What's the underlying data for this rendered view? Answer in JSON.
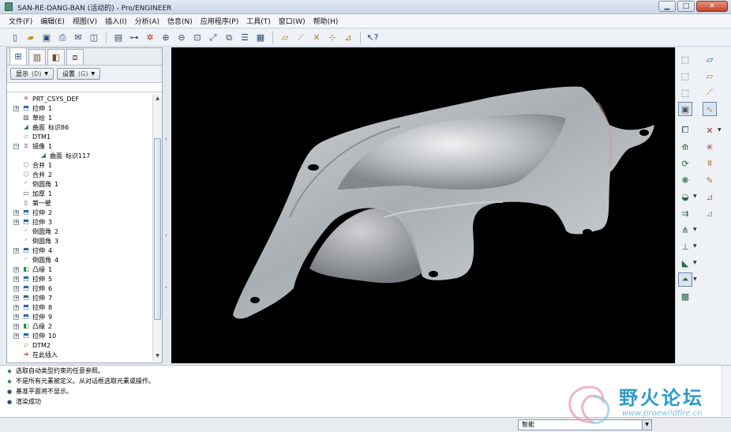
{
  "window": {
    "title": "SAN-RE-DANG-BAN (活动的) - Pro/ENGINEER"
  },
  "menu": [
    "文件(F)",
    "编辑(E)",
    "视图(V)",
    "插入(I)",
    "分析(A)",
    "信息(N)",
    "应用程序(P)",
    "工具(T)",
    "窗口(W)",
    "帮助(H)"
  ],
  "toolbar_icons": [
    "new-icon",
    "open-icon",
    "save-icon",
    "print-icon",
    "email-icon",
    "close-window-icon",
    "regenerate-icon",
    "datum-display-icon",
    "spin-center-icon",
    "zoom-in-icon",
    "zoom-out-icon",
    "refit-icon",
    "reorient-icon",
    "saved-views-icon",
    "layers-icon",
    "view-manager-icon",
    "plane-display-icon",
    "axis-display-icon",
    "point-display-icon",
    "csys-display-icon",
    "annotation-display-icon",
    "context-help-icon"
  ],
  "left_panel": {
    "show_label": "显示",
    "show_hint": "(D)",
    "settings_label": "设置",
    "settings_hint": "(G)"
  },
  "model_tree": [
    {
      "label": "PRT_CSYS_DEF",
      "suffix": "",
      "icon": "csys-icon",
      "level": 1,
      "expand": false
    },
    {
      "label": "拉伸",
      "suffix": "1",
      "icon": "extrude-icon",
      "level": 1,
      "expand": true
    },
    {
      "label": "草绘",
      "suffix": "1",
      "icon": "sketch-icon",
      "level": 1,
      "expand": false
    },
    {
      "label": "曲面",
      "suffix": "标识86",
      "icon": "surface-icon",
      "level": 1,
      "expand": false
    },
    {
      "label": "DTM1",
      "suffix": "",
      "icon": "datum-plane-icon",
      "level": 1,
      "expand": false
    },
    {
      "label": "镜像",
      "suffix": "1",
      "icon": "mirror-icon",
      "level": 1,
      "expand": true,
      "open": true
    },
    {
      "label": "曲面",
      "suffix": "标识117",
      "icon": "surface-icon",
      "level": 2,
      "expand": false
    },
    {
      "label": "合并",
      "suffix": "1",
      "icon": "merge-icon",
      "level": 1,
      "expand": false
    },
    {
      "label": "合并",
      "suffix": "2",
      "icon": "merge-icon",
      "level": 1,
      "expand": false
    },
    {
      "label": "倒圆角",
      "suffix": "1",
      "icon": "round-icon",
      "level": 1,
      "expand": false
    },
    {
      "label": "加厚",
      "suffix": "1",
      "icon": "thicken-icon",
      "level": 1,
      "expand": false
    },
    {
      "label": "第一壁",
      "suffix": "",
      "icon": "wall-icon",
      "level": 1,
      "expand": false
    },
    {
      "label": "拉伸",
      "suffix": "2",
      "icon": "extrude-icon",
      "level": 1,
      "expand": true
    },
    {
      "label": "拉伸",
      "suffix": "3",
      "icon": "extrude-icon",
      "level": 1,
      "expand": true
    },
    {
      "label": "倒圆角",
      "suffix": "2",
      "icon": "round-icon",
      "level": 1,
      "expand": false
    },
    {
      "label": "倒圆角",
      "suffix": "3",
      "icon": "round-icon",
      "level": 1,
      "expand": false
    },
    {
      "label": "拉伸",
      "suffix": "4",
      "icon": "extrude-icon",
      "level": 1,
      "expand": true
    },
    {
      "label": "倒圆角",
      "suffix": "4",
      "icon": "round-icon",
      "level": 1,
      "expand": false
    },
    {
      "label": "凸缘",
      "suffix": "1",
      "icon": "flange-icon",
      "level": 1,
      "expand": true
    },
    {
      "label": "拉伸",
      "suffix": "5",
      "icon": "extrude-icon",
      "level": 1,
      "expand": true
    },
    {
      "label": "拉伸",
      "suffix": "6",
      "icon": "extrude-icon",
      "level": 1,
      "expand": true
    },
    {
      "label": "拉伸",
      "suffix": "7",
      "icon": "extrude-icon",
      "level": 1,
      "expand": true
    },
    {
      "label": "拉伸",
      "suffix": "8",
      "icon": "extrude-icon",
      "level": 1,
      "expand": true
    },
    {
      "label": "拉伸",
      "suffix": "9",
      "icon": "extrude-icon",
      "level": 1,
      "expand": true
    },
    {
      "label": "凸缘",
      "suffix": "2",
      "icon": "flange-icon",
      "level": 1,
      "expand": true
    },
    {
      "label": "拉伸",
      "suffix": "10",
      "icon": "extrude-icon",
      "level": 1,
      "expand": true
    },
    {
      "label": "DTM2",
      "suffix": "",
      "icon": "datum-plane-icon",
      "level": 1,
      "expand": false
    },
    {
      "label": "在此插入",
      "suffix": "",
      "icon": "insert-here-icon",
      "level": 1,
      "expand": false
    }
  ],
  "messages": [
    {
      "icon": "ok",
      "text": "选取自动类型约束的任意参照。"
    },
    {
      "icon": "ok",
      "text": "不是所有元素被定义。从对话框选取元素或操作。"
    },
    {
      "icon": "bullet",
      "text": "基准平面将不显示。"
    },
    {
      "icon": "bullet",
      "text": "渲染成功"
    }
  ],
  "status": {
    "filter_value": "智能"
  },
  "watermark": {
    "title": "野火论坛",
    "url": "www.proewildfire.cn"
  }
}
